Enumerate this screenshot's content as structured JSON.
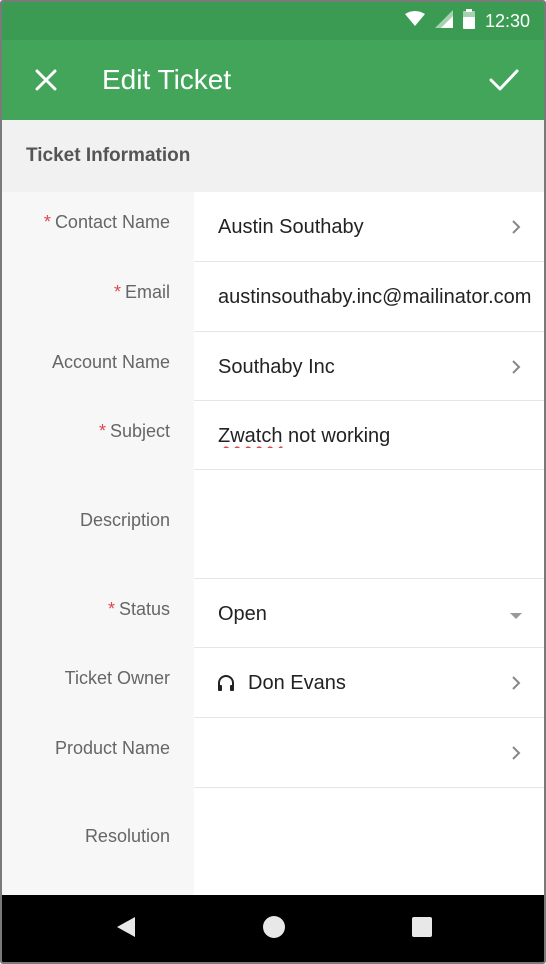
{
  "status_bar": {
    "time": "12:30",
    "icons": [
      "wifi-icon",
      "signal-icon",
      "battery-icon"
    ]
  },
  "app_bar": {
    "title": "Edit Ticket",
    "close_icon": "close-icon",
    "save_icon": "check-icon",
    "color": "#43a55a"
  },
  "section": {
    "title": "Ticket Information"
  },
  "fields": {
    "contact_name": {
      "label": "Contact Name",
      "required": "*",
      "value": "Austin Southaby"
    },
    "email": {
      "label": "Email",
      "required": "*",
      "value": "austinsouthaby.inc@mailinator.com"
    },
    "account_name": {
      "label": "Account Name",
      "value": "Southaby Inc"
    },
    "subject": {
      "label": "Subject",
      "required": "*",
      "value_misspelled": "Zwatch",
      "value_rest": " not working"
    },
    "description": {
      "label": "Description",
      "value": ""
    },
    "status": {
      "label": "Status",
      "required": "*",
      "value": "Open"
    },
    "ticket_owner": {
      "label": "Ticket Owner",
      "value": "Don Evans"
    },
    "product_name": {
      "label": "Product Name",
      "value": ""
    },
    "resolution": {
      "label": "Resolution",
      "value": ""
    }
  },
  "colors": {
    "required": "#e0474c",
    "header": "#43a55a",
    "status_bar": "#3b9b52"
  }
}
